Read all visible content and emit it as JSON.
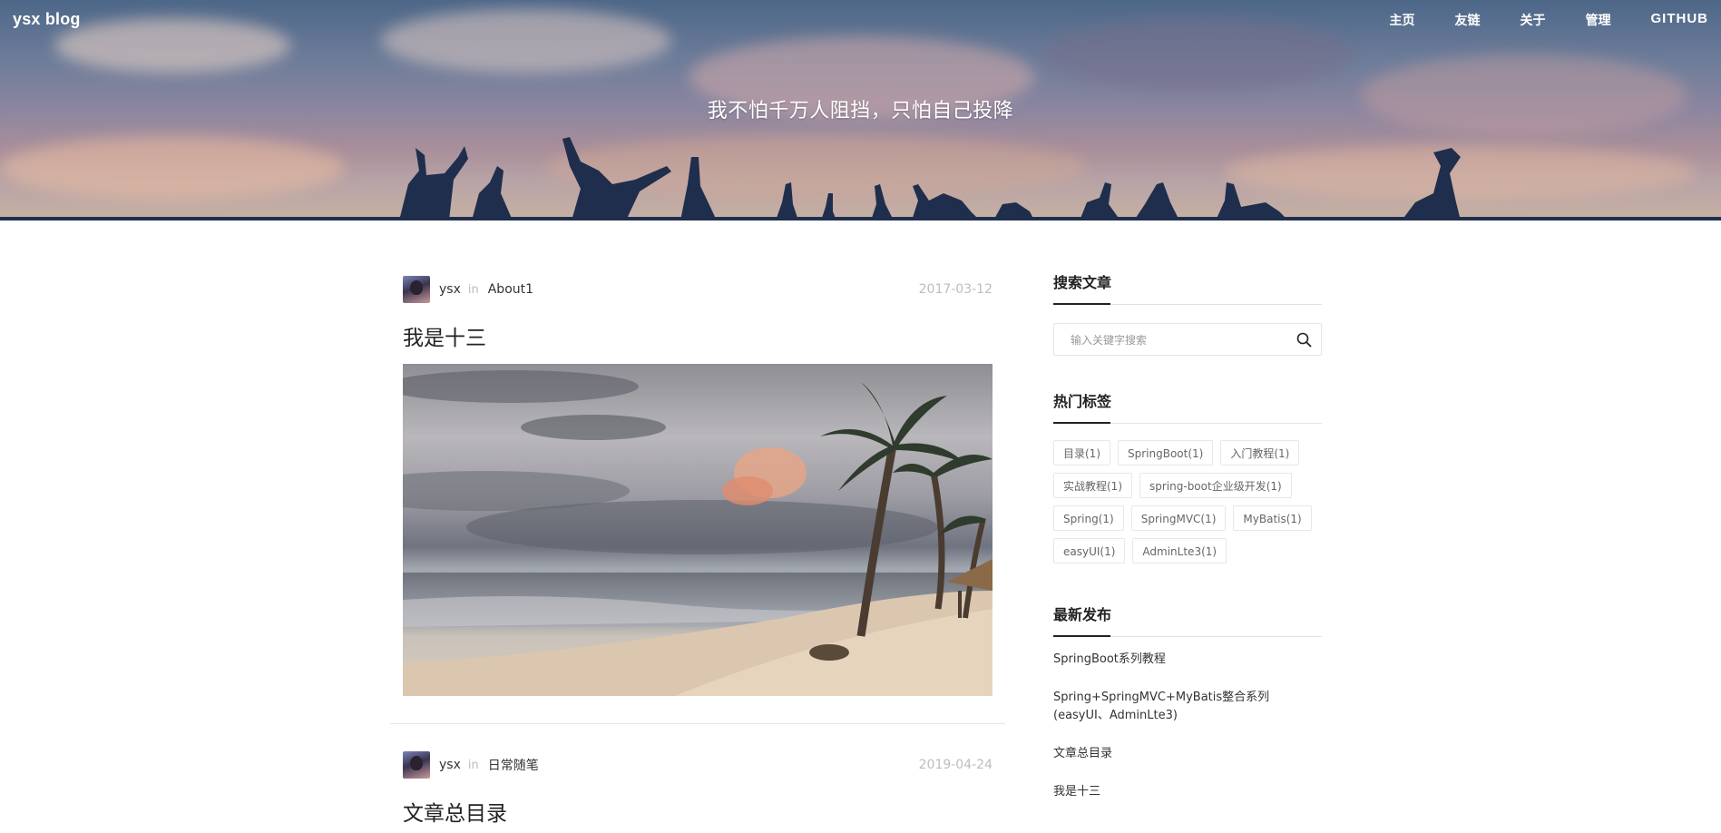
{
  "header": {
    "brand": "ysx blog",
    "nav": [
      {
        "label": "主页"
      },
      {
        "label": "友链"
      },
      {
        "label": "关于"
      },
      {
        "label": "管理"
      },
      {
        "label": "GITHUB"
      }
    ],
    "slogan": "我不怕千万人阻挡，只怕自己投降"
  },
  "posts": [
    {
      "author": "ysx",
      "in": "in",
      "category": "About1",
      "date": "2017-03-12",
      "title": "我是十三"
    },
    {
      "author": "ysx",
      "in": "in",
      "category": "日常随笔",
      "date": "2019-04-24",
      "title": "文章总目录"
    }
  ],
  "sidebar": {
    "search": {
      "title": "搜索文章",
      "placeholder": "输入关键字搜索",
      "icon": "search-icon"
    },
    "tags": {
      "title": "热门标签",
      "items": [
        "目录(1)",
        "SpringBoot(1)",
        "入门教程(1)",
        "实战教程(1)",
        "spring-boot企业级开发(1)",
        "Spring(1)",
        "SpringMVC(1)",
        "MyBatis(1)",
        "easyUI(1)",
        "AdminLte3(1)"
      ]
    },
    "recent": {
      "title": "最新发布",
      "items": [
        "SpringBoot系列教程",
        "Spring+SpringMVC+MyBatis整合系列(easyUI、AdminLte3)",
        "文章总目录",
        "我是十三"
      ]
    }
  }
}
